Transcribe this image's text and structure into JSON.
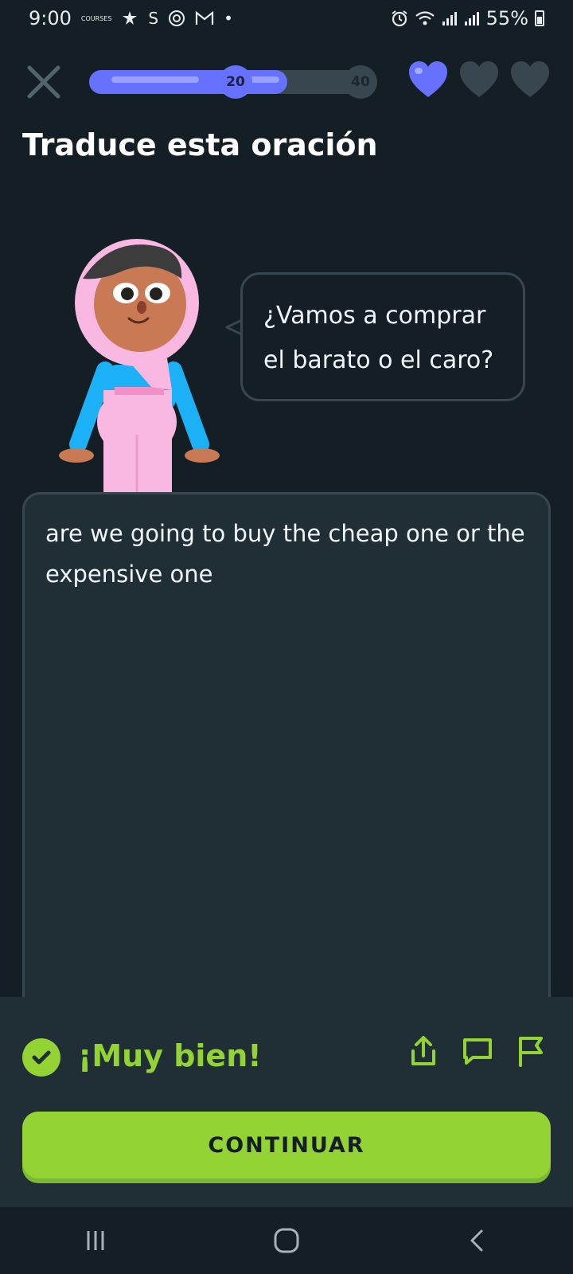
{
  "status_bar": {
    "time": "9:00",
    "notifications": [
      "courses-icon",
      "slack-icon",
      "s-icon",
      "swirl-icon",
      "gmail-icon",
      "dot"
    ],
    "battery": "55%",
    "tiny_label": "COURSES"
  },
  "lesson": {
    "progress_percent": 70,
    "milestones": [
      "20",
      "40"
    ],
    "hearts": {
      "filled": 1,
      "empty": 2
    }
  },
  "exercise": {
    "title": "Traduce esta oración",
    "prompt_line1": "¿Vamos a comprar",
    "prompt_line2": "el barato o el caro?",
    "answer": "are we going to buy the cheap one or the expensive one"
  },
  "feedback": {
    "title": "¡Muy bien!",
    "continue_label": "CONTINUAR"
  },
  "colors": {
    "background": "#131f24",
    "panel": "#202f36",
    "border": "#37464f",
    "accent_blue": "#6672ff",
    "success_green": "#93d333",
    "hijab_pink": "#f9b8e1",
    "shirt_blue": "#1cb0f6",
    "skin": "#c97a55"
  }
}
